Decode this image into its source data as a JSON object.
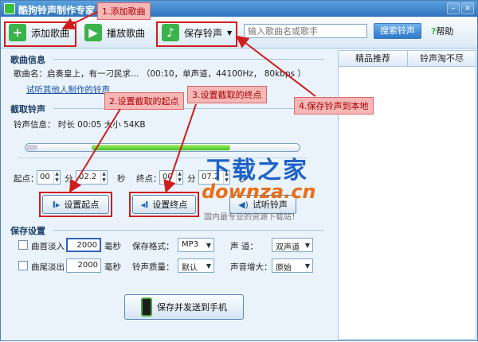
{
  "window": {
    "title": "酷狗铃声制作专家"
  },
  "toolbar": {
    "add_song": "添加歌曲",
    "play_song": "播放歌曲",
    "save_ringtone": "保存铃声",
    "search_placeholder": "输入歌曲名或歌手",
    "search_button": "搜索铃声",
    "help": "帮助"
  },
  "song_info": {
    "section_title": "歌曲信息",
    "name_line": "歌曲名：启奏皇上，有一刁民求…  （00:10，单声道，44100Hz，  80kbps ）",
    "try_link": "试听其他人制作的铃声"
  },
  "capture": {
    "section_title": "截取铃声",
    "ringtone_info": "铃声信息：  时长 00:05  大小  54KB",
    "start_label": "起点：",
    "start_min": "00",
    "min_unit": "分",
    "start_sec": "02.2",
    "sec_unit": "秒",
    "end_label": "终点：",
    "end_min": "00",
    "end_sec": "07.2",
    "btn_set_start": "设置起点",
    "btn_set_end": "设置终点",
    "btn_preview": "试听铃声",
    "fill_start": 0.24,
    "fill_end": 0.75
  },
  "save_settings": {
    "section_title": "保存设置",
    "fade_in_label": "曲首淡入",
    "fade_in_value": "2000",
    "fade_out_label": "曲尾淡出",
    "fade_out_value": "2000",
    "ms_unit": "毫秒",
    "format_label": "保存格式：",
    "format_value": "MP3",
    "quality_label": "铃声质量：",
    "quality_value": "默认",
    "channel_label": "声      道：",
    "channel_value": "双声道",
    "volume_label": "声音增大：",
    "volume_value": "原始",
    "send_button": "保存并发送到手机"
  },
  "right_panel": {
    "tab1": "精品推荐",
    "tab2": "铃声淘不尽"
  },
  "annotations": {
    "a1": "1.添加歌曲",
    "a2": "2.设置截取的起点",
    "a3": "3.设置截取的终点",
    "a4": "4.保存铃声到本地"
  },
  "watermark": {
    "line1": "下载之家",
    "line2": "downza.cn",
    "line3": "国内最专业的资源下载站！"
  },
  "colors": {
    "accent": "#2f73bd",
    "annotation_red": "#d01d1d",
    "progress_green": "#3fbf1f"
  }
}
